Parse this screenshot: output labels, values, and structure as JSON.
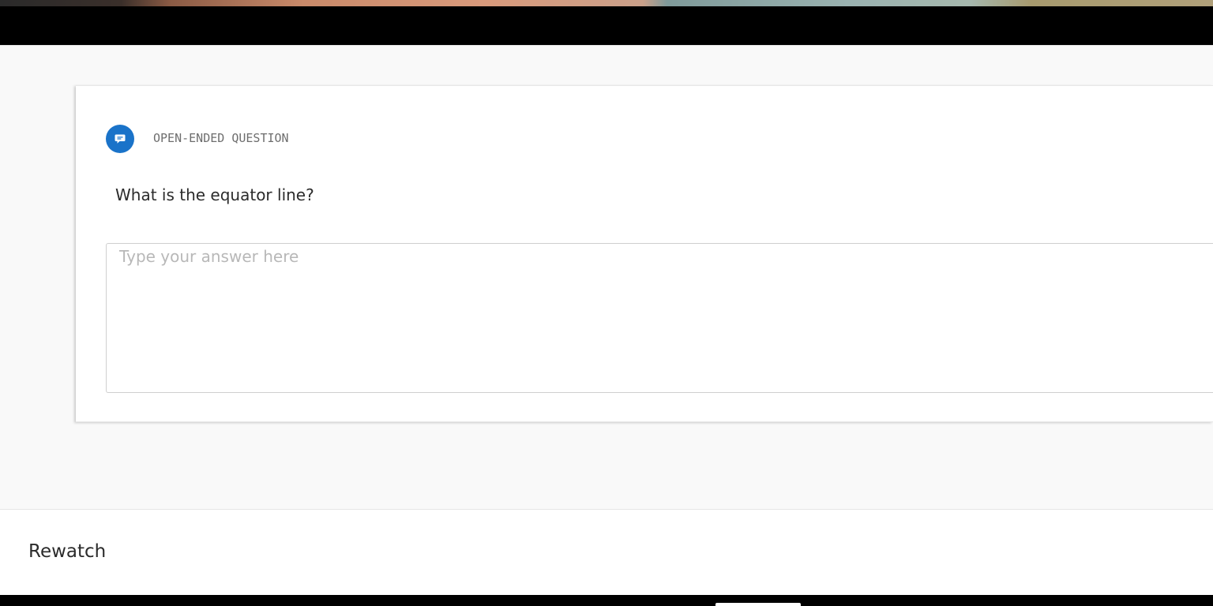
{
  "question": {
    "type_label": "OPEN-ENDED QUESTION",
    "icon": "speech-bubble-icon",
    "text": "What is the equator line?",
    "answer_value": "",
    "answer_placeholder": "Type your answer here"
  },
  "footer": {
    "rewatch_label": "Rewatch"
  },
  "colors": {
    "accent": "#1a73c9",
    "page_background": "#f9f9f9",
    "card_background": "#ffffff",
    "text_primary": "#2b2b2b",
    "text_muted": "#6e6e6e",
    "placeholder": "#b8b8b8"
  }
}
